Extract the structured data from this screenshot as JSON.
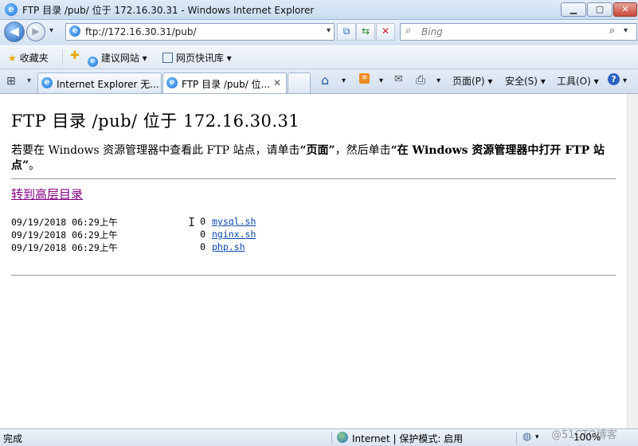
{
  "window": {
    "title": "FTP 目录 /pub/ 位于 172.16.30.31 - Windows Internet Explorer",
    "minimize": "▁",
    "maximize": "▢",
    "close": "✕"
  },
  "navbar": {
    "address": "ftp://172.16.30.31/pub/",
    "search_placeholder": "Bing"
  },
  "favorites": {
    "label": "收藏夹",
    "items": [
      "建议网站 ▾",
      "网页快讯库 ▾"
    ]
  },
  "tabs": [
    {
      "label": "Internet Explorer 无..."
    },
    {
      "label": "FTP 目录 /pub/ 位...",
      "close": "✕"
    }
  ],
  "toolbar": {
    "page": "页面(P) ▾",
    "safety": "安全(S) ▾",
    "tools": "工具(O) ▾"
  },
  "page": {
    "heading": "FTP 目录 /pub/ 位于 172.16.30.31",
    "desc_prefix": "若要在 Windows 资源管理器中查看此 FTP 站点，请单击",
    "desc_page": "“页面”",
    "desc_middle": "，然后单击",
    "desc_action": "“在 Windows 资源管理器中打开 FTP 站点”",
    "desc_suffix": "。",
    "up_link": "转到高层目录",
    "files": [
      {
        "date": "09/19/2018 06:29上午",
        "size": "0",
        "name": "mysql.sh"
      },
      {
        "date": "09/19/2018 06:29上午",
        "size": "0",
        "name": "nginx.sh"
      },
      {
        "date": "09/19/2018 06:29上午",
        "size": "0",
        "name": "php.sh"
      }
    ]
  },
  "status": {
    "left": "完成",
    "zone": "Internet | 保护模式: 启用",
    "zoom": "100%",
    "watermark": "@51CTO博客"
  }
}
